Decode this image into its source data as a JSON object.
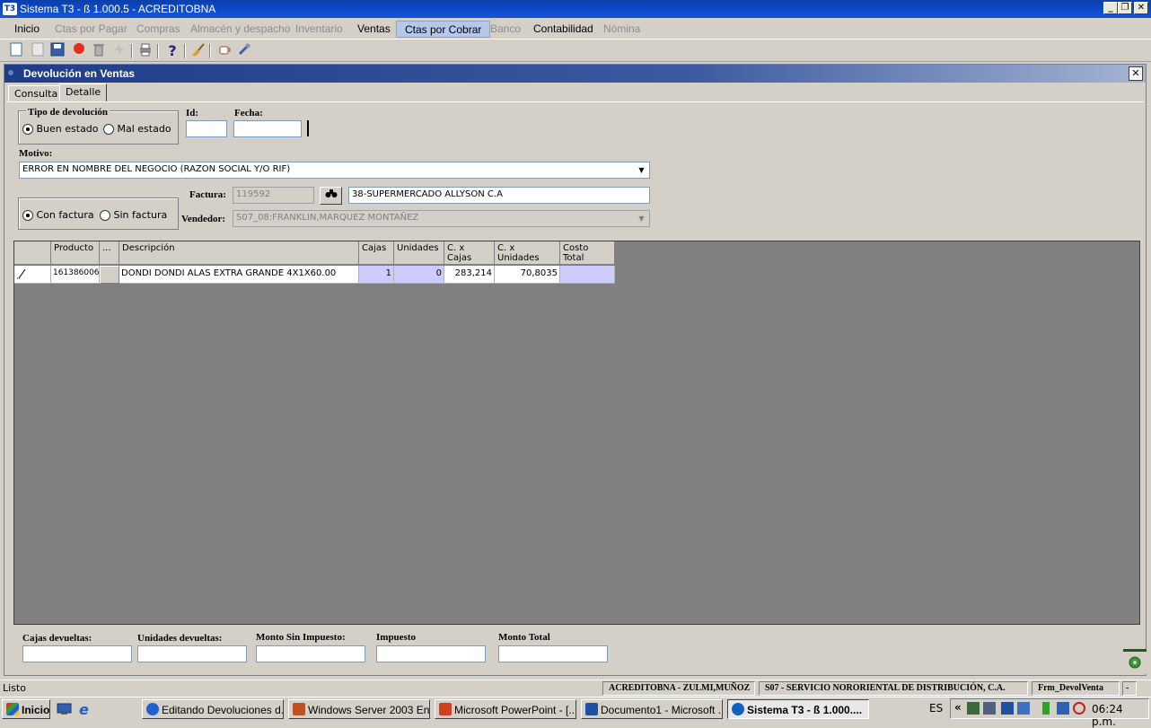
{
  "window": {
    "title": "Sistema T3 - ß 1.000.5 - ACREDITOBNA",
    "logo": "T3"
  },
  "menu": [
    {
      "label": "Inicio",
      "enabled": true
    },
    {
      "label": "Ctas por Pagar",
      "enabled": false
    },
    {
      "label": "Compras",
      "enabled": false
    },
    {
      "label": "Almacén y despacho",
      "enabled": false
    },
    {
      "label": "Inventario",
      "enabled": false
    },
    {
      "label": "Ventas",
      "enabled": true
    },
    {
      "label": "Ctas por Cobrar",
      "enabled": true,
      "active": true
    },
    {
      "label": "Banco",
      "enabled": false
    },
    {
      "label": "Contabilidad",
      "enabled": true
    },
    {
      "label": "Nómina",
      "enabled": false
    }
  ],
  "toolbar": [
    "new-icon",
    "blank-icon",
    "save-icon",
    "record-icon",
    "trash-icon",
    "lightning-icon",
    "print-icon",
    "help-icon",
    "broom-icon",
    "cup-icon",
    "tools-icon"
  ],
  "child": {
    "title": "Devolución en Ventas",
    "close": "✕"
  },
  "tabs": {
    "consulta": "Consulta",
    "detalle": "Detalle"
  },
  "form": {
    "tipo_label": "Tipo de devolución",
    "buen": "Buen estado",
    "mal": "Mal estado",
    "id_label": "Id:",
    "id_value": "",
    "fecha_label": "Fecha:",
    "fecha_value": "",
    "motivo_label": "Motivo:",
    "motivo_value": "ERROR EN NOMBRE DEL NEGOCIO (RAZON SOCIAL Y/O RIF)",
    "con": "Con factura",
    "sin": "Sin factura",
    "factura_label": "Factura:",
    "factura_value": "119592",
    "cliente_value": "38-SUPERMERCADO ALLYSON C.A",
    "vendedor_label": "Vendedor:",
    "vendedor_value": "S07_08:FRANKLIN,MARQUEZ MONTAÑEZ"
  },
  "grid": {
    "headers": {
      "producto": "Producto",
      "dots": "...",
      "descripcion": "Descripción",
      "cajas": "Cajas",
      "unidades": "Unidades",
      "cx_cajas": "C. x Cajas",
      "cx_unidades": "C. x Unidades",
      "costo_total": "Costo Total"
    },
    "row": {
      "producto": "161386006",
      "descripcion": "DONDI DONDI ALAS EXTRA GRANDE 4X1X60.00",
      "cajas": "1",
      "unidades": "0",
      "cx_cajas": "283,214",
      "cx_unidades": "70,8035",
      "costo_total": ""
    }
  },
  "totals": {
    "cajas": "Cajas devueltas:",
    "unidades": "Unidades devueltas:",
    "monto_sin": "Monto Sin Impuesto:",
    "impuesto": "Impuesto",
    "monto_total": "Monto Total"
  },
  "status": {
    "left": "Listo",
    "user": "ACREDITOBNA - ZULMI,MUÑOZ",
    "company": "S07 - SERVICIO NORORIENTAL DE DISTRIBUCIÓN, C.A.",
    "form": "Frm_DevolVenta",
    "dash": "-"
  },
  "taskbar": {
    "start": "Inicio",
    "items": [
      "Editando Devoluciones d...",
      "Windows Server 2003 En...",
      "Microsoft PowerPoint - [...",
      "Documento1 - Microsoft ...",
      "Sistema T3 - ß 1.000...."
    ],
    "lang": "ES",
    "clock": "06:24 p.m."
  }
}
